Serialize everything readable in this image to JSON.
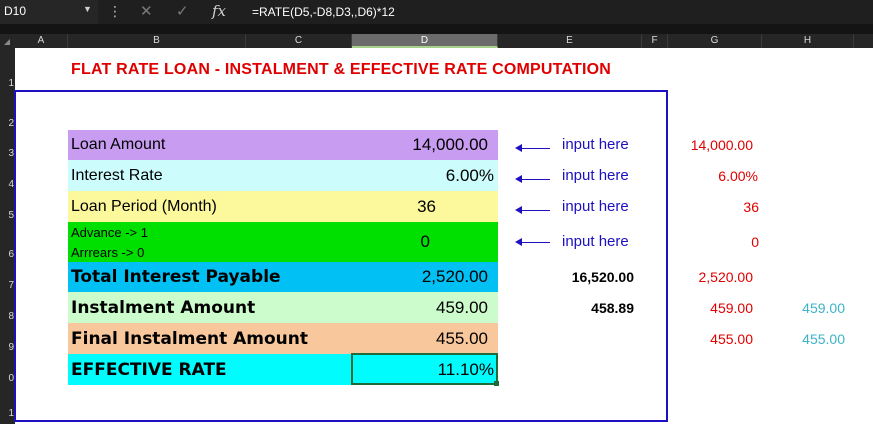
{
  "formula_bar": {
    "name_box": "D10",
    "name_box_arrow": "▼",
    "more_icon": "⋮",
    "cancel_icon": "✕",
    "enter_icon": "✓",
    "fx_label": "fx",
    "formula": "=RATE(D5,-D8,D3,,D6)*12"
  },
  "columns": [
    "A",
    "B",
    "C",
    "D",
    "E",
    "F",
    "G",
    "H"
  ],
  "selected_column": "D",
  "rows": [
    "1",
    "2",
    "3",
    "4",
    "5",
    "6",
    "7",
    "8",
    "9",
    "0",
    "1"
  ],
  "title": "FLAT RATE LOAN - INSTALMENT & EFFECTIVE RATE COMPUTATION",
  "table": {
    "loan_amount": {
      "label": "Loan Amount",
      "value": "14,000.00"
    },
    "interest_rate": {
      "label": "Interest Rate",
      "value": "6.00%"
    },
    "loan_period": {
      "label": "Loan Period (Month)",
      "value": "36"
    },
    "advance": {
      "label_line1": "Advance -> 1",
      "label_line2": "Arrrears -> 0",
      "value": "0"
    },
    "total_interest": {
      "label": "Total Interest Payable",
      "value": "2,520.00"
    },
    "instalment": {
      "label": "Instalment Amount",
      "value": "459.00"
    },
    "final_instalment": {
      "label": "Final Instalment Amount",
      "value": "455.00"
    },
    "effective_rate": {
      "label": "EFFECTIVE RATE",
      "value": "11.10%"
    }
  },
  "input_hint": "input here",
  "col_e": {
    "row7": "16,520.00",
    "row8": "458.89"
  },
  "col_g": {
    "row3": "14,000.00",
    "row4": "6.00%",
    "row5": "36",
    "row6": "0",
    "row7": "2,520.00",
    "row8": "459.00",
    "row9": "455.00"
  },
  "col_h": {
    "row8": "459.00",
    "row9": "455.00"
  },
  "colors": {
    "loan_amount_fill": "#c89cf0",
    "interest_rate_fill": "#ccfcfc",
    "loan_period_fill": "#fcf89c",
    "advance_fill": "#00e000",
    "total_interest_fill": "#00c0f4",
    "instalment_fill": "#ccfccc",
    "final_instalment_fill": "#f8c89c",
    "effective_rate_fill": "#00fcfc",
    "title_red": "#e00000",
    "frame_blue": "#1c10c0",
    "teal": "#3cb4c8"
  }
}
